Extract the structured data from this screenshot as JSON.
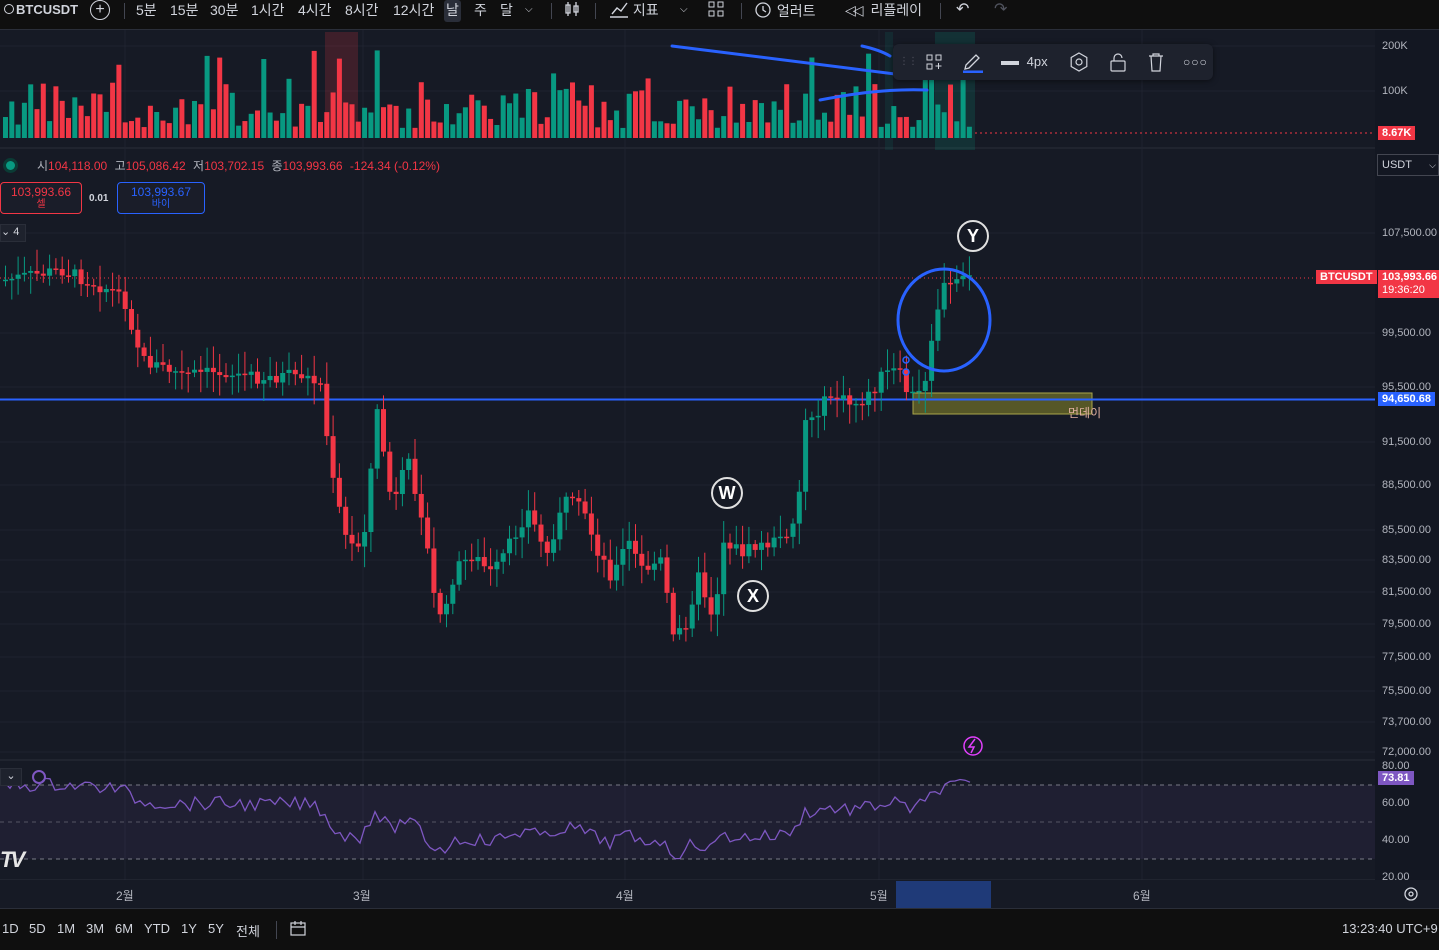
{
  "topbar": {
    "symbol": "BTCUSDT",
    "intervals": [
      "5분",
      "15분",
      "30분",
      "1시간",
      "4시간",
      "8시간",
      "12시간",
      "날",
      "주",
      "달"
    ],
    "active_interval": "날",
    "indicators_label": "지표",
    "alert_label": "얼러트",
    "replay_label": "리플레이"
  },
  "drawing_toolbar": {
    "width_label": "4px"
  },
  "ohlc": {
    "o_key": "시",
    "o_val": "104,118.00",
    "h_key": "고",
    "h_val": "105,086.42",
    "l_key": "저",
    "l_val": "103,702.15",
    "c_key": "종",
    "c_val": "103,993.66",
    "change": "-124.34 (-0.12%)"
  },
  "trade": {
    "sell_price": "103,993.66",
    "sell_label": "셀",
    "spread": "0.01",
    "buy_price": "103,993.67",
    "buy_label": "바이"
  },
  "price_axis": {
    "currency": "USDT",
    "labels": [
      "107,500.00",
      "99,500.00",
      "95,500.00",
      "91,500.00",
      "88,500.00",
      "85,500.00",
      "83,500.00",
      "81,500.00",
      "79,500.00",
      "77,500.00",
      "75,500.00",
      "73,700.00",
      "72,000.00"
    ],
    "volume_labels": [
      "200K",
      "100K"
    ],
    "volume_last": "8.67K",
    "symbol_tag": "BTCUSDT",
    "last_price": "103,993.66",
    "countdown": "19:36:20",
    "hline_price": "94,650.68",
    "rsi_labels": [
      "80.00",
      "60.00",
      "40.00",
      "20.00"
    ],
    "rsi_value": "73.81"
  },
  "annotations": {
    "wave_w": "W",
    "wave_x": "X",
    "wave_y": "Y",
    "hline_text": "먼데이",
    "collapse_count": "4",
    "watermark": "TV"
  },
  "time_axis": {
    "labels": [
      "2월",
      "3월",
      "4월",
      "5월",
      "6월"
    ]
  },
  "bottombar": {
    "ranges": [
      "1D",
      "5D",
      "1M",
      "3M",
      "6M",
      "YTD",
      "1Y",
      "5Y",
      "전체"
    ],
    "clock": "13:23:40 UTC+9"
  },
  "colors": {
    "up": "#089981",
    "down": "#f23645",
    "hline": "#2962ff",
    "rsi": "#7e57c2",
    "bg": "#161a25"
  },
  "icons": [
    "add-symbol-icon",
    "bar-type-icon",
    "indicators-icon",
    "layout-icon",
    "alert-icon",
    "replay-icon",
    "undo-icon",
    "redo-icon",
    "drag-handle-icon",
    "template-icon",
    "pencil-icon",
    "line-width-icon",
    "settings-icon",
    "lock-icon",
    "trash-icon",
    "more-icon",
    "calendar-icon",
    "lightning-icon",
    "sync-icon"
  ]
}
